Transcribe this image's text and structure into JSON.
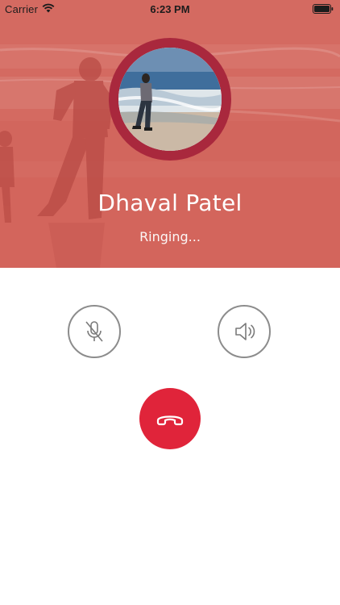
{
  "status_bar": {
    "carrier": "Carrier",
    "time": "6:23 PM",
    "wifi_icon": "wifi-icon",
    "battery_icon": "battery-icon"
  },
  "caller": {
    "name": "Dhaval Patel",
    "status": "Ringing..."
  },
  "controls": {
    "mute_icon": "mic-off-icon",
    "speaker_icon": "speaker-icon",
    "end_call_icon": "phone-hangup-icon"
  },
  "colors": {
    "hero_tint": "#d8685f",
    "avatar_ring": "#a9283d",
    "end_call": "#e0243a",
    "control_border": "#8c8c8c"
  }
}
